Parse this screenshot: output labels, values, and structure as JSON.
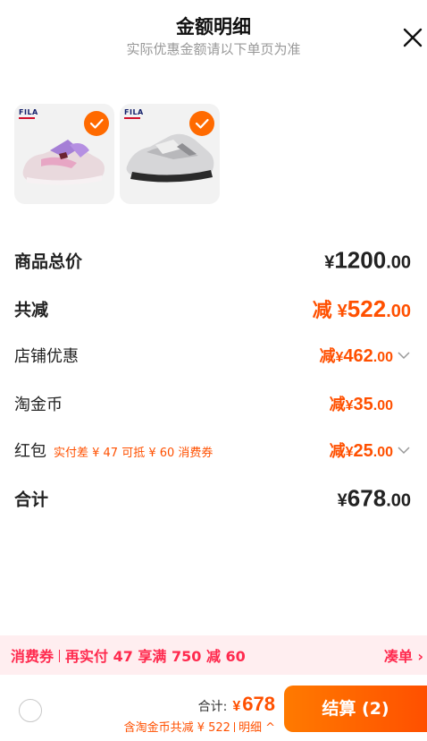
{
  "header": {
    "title": "金额明细",
    "subtitle": "实际优惠金额请以下单页为准"
  },
  "products": [
    {
      "brand": "FILA",
      "selected": true,
      "icon": "check-icon"
    },
    {
      "brand": "FILA",
      "selected": true,
      "icon": "check-icon"
    }
  ],
  "breakdown": {
    "total_price": {
      "label": "商品总价",
      "yen": "¥",
      "int": "1200",
      "dec": ".00"
    },
    "total_discount": {
      "label": "共减",
      "prefix": "减",
      "yen": "¥",
      "int": "522",
      "dec": ".00"
    },
    "store_discount": {
      "label": "店铺优惠",
      "prefix": "减",
      "yen": "¥",
      "int": "462",
      "dec": ".00"
    },
    "taojinbi": {
      "label": "淘金币",
      "prefix": "减",
      "yen": "¥",
      "int": "35",
      "dec": ".00"
    },
    "red_packet": {
      "label": "红包",
      "note": "实付差 ¥ 47 可抵 ¥ 60 消费券",
      "prefix": "减",
      "yen": "¥",
      "int": "25",
      "dec": ".00"
    },
    "subtotal": {
      "label": "合计",
      "yen": "¥",
      "int": "678",
      "dec": ".00"
    }
  },
  "promo": {
    "tag": "消费券",
    "text": "再实付 47 享满 750 减 60",
    "link": "凑单 ›"
  },
  "footer": {
    "total_label": "合计:",
    "total_yen": "¥",
    "total_value": "678",
    "detail_text": "含淘金币共减 ¥ 522",
    "detail_link": "明细 ^",
    "checkout_label": "结算 (2)"
  },
  "colors": {
    "accent": "#ff5000",
    "promo_text": "#ff2a4e",
    "promo_bg": "#ffeef0"
  }
}
